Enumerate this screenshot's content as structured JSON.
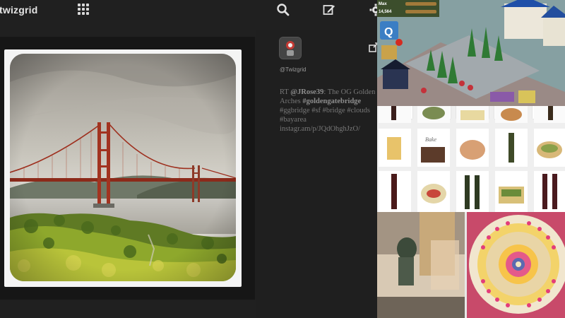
{
  "app": {
    "title": "twizgrid",
    "toolbar": {
      "grid_icon": "grid-icon",
      "search_icon": "search-icon",
      "compose_icon": "compose-icon",
      "settings_icon": "gear-icon"
    }
  },
  "tweet": {
    "handle": "@Twizgrid",
    "text_prefix": "RT ",
    "mention": "@JRose39",
    "text_body": ": The OG Golden Arches ",
    "hashtag_main": "#goldengatebridge",
    "hashtags": "#ggbridge #sf #bridge #clouds #bayarea",
    "link": "instagr.am/p/JQdOhghJzO/",
    "share_icon": "share-icon",
    "photo_subject": "Golden Gate Bridge photo"
  },
  "game": {
    "hud_max_label": "Max",
    "hud_coins": "14,564"
  },
  "colors": {
    "background": "#202020",
    "panel": "#161616",
    "bridge": "#b23a26"
  }
}
